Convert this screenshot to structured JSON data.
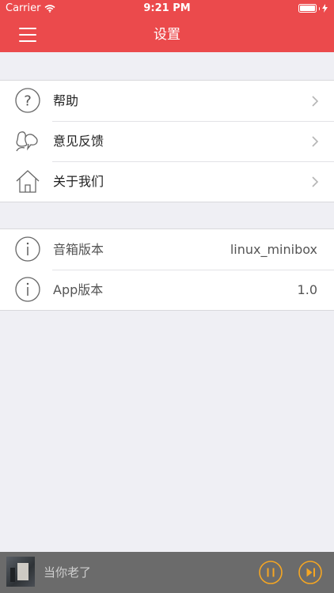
{
  "status_bar": {
    "carrier": "Carrier",
    "time": "9:21 PM"
  },
  "navbar": {
    "title": "设置",
    "menu_icon": "hamburger-icon"
  },
  "menu_group": [
    {
      "label": "帮助",
      "icon": "help-icon"
    },
    {
      "label": "意见反馈",
      "icon": "feedback-icon"
    },
    {
      "label": "关于我们",
      "icon": "home-icon"
    }
  ],
  "info_group": [
    {
      "label": "音箱版本",
      "value": "linux_minibox",
      "icon": "info-icon"
    },
    {
      "label": "App版本",
      "value": "1.0",
      "icon": "info-icon"
    }
  ],
  "player": {
    "song_title": "当你老了",
    "accent_color": "#f5a623",
    "pause_icon": "pause-icon",
    "next_icon": "skip-next-icon"
  },
  "colors": {
    "header": "#eb4a4c",
    "background": "#efeff4",
    "player": "#6b6b6b"
  }
}
